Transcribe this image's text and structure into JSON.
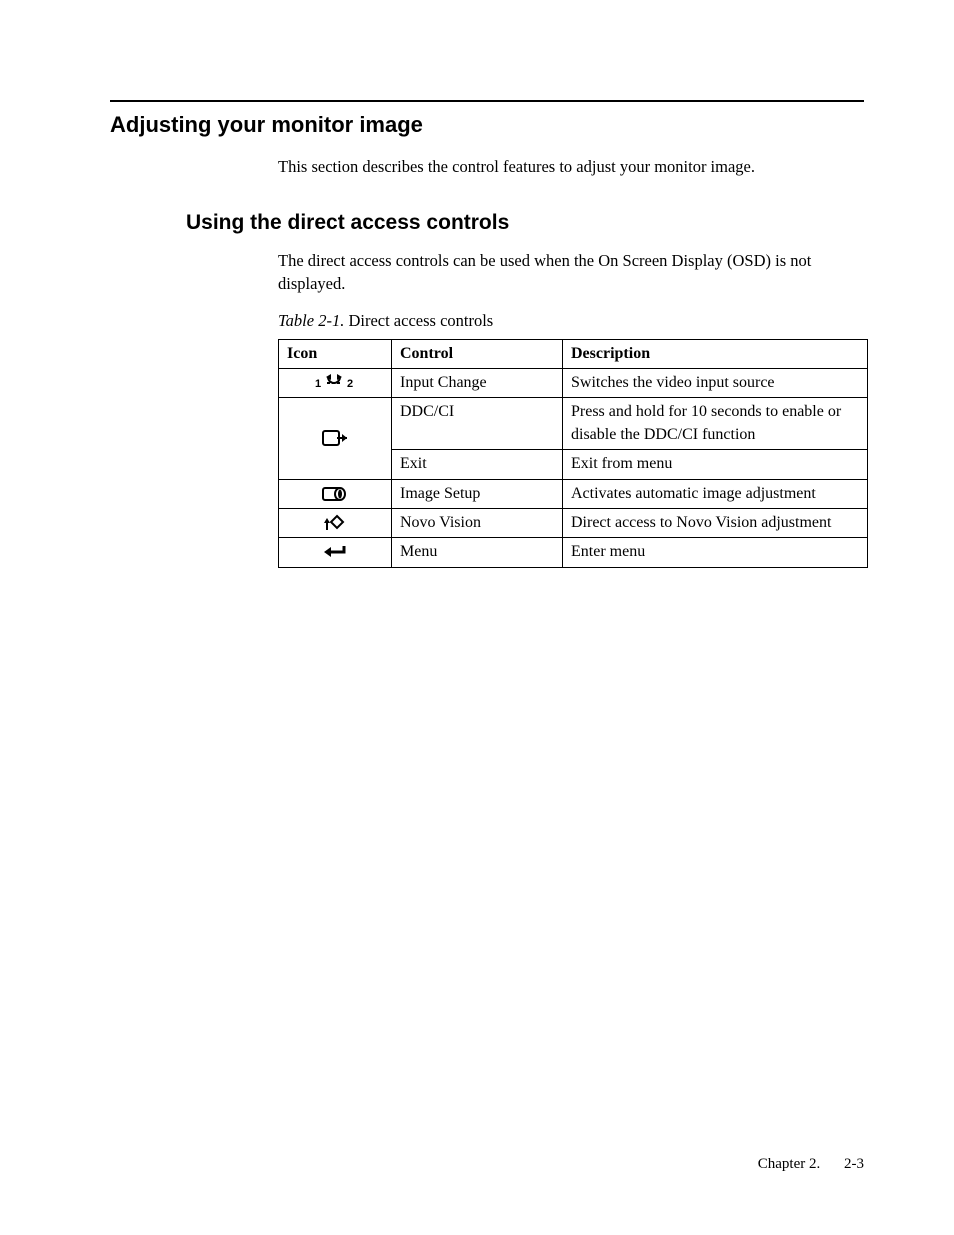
{
  "section": {
    "title": "Adjusting your monitor image",
    "intro": "This section describes the control features to adjust your monitor image."
  },
  "subsection": {
    "title": "Using the direct access controls",
    "intro": "The direct access controls can be used when the On Screen Display (OSD) is not displayed."
  },
  "table": {
    "caption_label": "Table 2-1.",
    "caption_text": "Direct access controls",
    "headers": {
      "icon": "Icon",
      "control": "Control",
      "description": "Description"
    },
    "rows": [
      {
        "icon": "input-change-icon",
        "control": "Input Change",
        "description": "Switches the video input source"
      },
      {
        "icon": "exit-icon",
        "control": "DDC/CI",
        "description": "Press and hold for 10 seconds to enable or disable the DDC/CI function"
      },
      {
        "icon": "",
        "control": "Exit",
        "description": "Exit from menu"
      },
      {
        "icon": "image-setup-icon",
        "control": "Image Setup",
        "description": "Activates automatic image adjustment"
      },
      {
        "icon": "novo-vision-icon",
        "control": "Novo Vision",
        "description": "Direct access to Novo Vision adjustment"
      },
      {
        "icon": "menu-icon",
        "control": "Menu",
        "description": "Enter menu"
      }
    ]
  },
  "footer": {
    "chapter": "Chapter 2.",
    "page": "2-3"
  }
}
